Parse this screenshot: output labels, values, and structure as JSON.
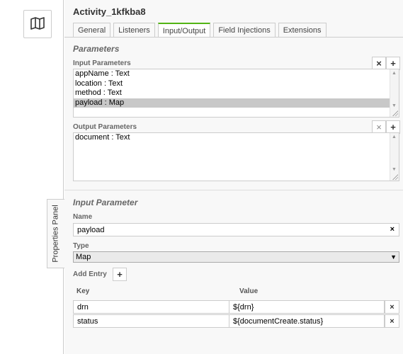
{
  "canvas": {
    "map_icon": "map-icon",
    "properties_tab_label": "Properties Panel"
  },
  "panel": {
    "title": "Activity_1kfkba8",
    "tabs": [
      {
        "label": "General",
        "active": false
      },
      {
        "label": "Listeners",
        "active": false
      },
      {
        "label": "Input/Output",
        "active": true
      },
      {
        "label": "Field Injections",
        "active": false
      },
      {
        "label": "Extensions",
        "active": false
      }
    ],
    "accent_color": "#52b415"
  },
  "parameters": {
    "group_title": "Parameters",
    "input": {
      "label": "Input Parameters",
      "items": [
        "appName : Text",
        "location : Text",
        "method : Text",
        "payload : Map"
      ],
      "selected": "payload : Map",
      "remove_label": "×",
      "add_label": "+"
    },
    "output": {
      "label": "Output Parameters",
      "items": [
        "document : Text"
      ],
      "remove_label": "×",
      "add_label": "+"
    }
  },
  "input_parameter": {
    "group_title": "Input Parameter",
    "name_label": "Name",
    "name_value": "payload",
    "clear_label": "×",
    "type_label": "Type",
    "type_value": "Map",
    "add_entry_label": "Add Entry",
    "add_entry_button": "+",
    "key_header": "Key",
    "value_header": "Value",
    "entries": [
      {
        "key": "drn",
        "value": "${drn}"
      },
      {
        "key": "status",
        "value": "${documentCreate.status}"
      }
    ],
    "remove_entry_label": "×"
  }
}
